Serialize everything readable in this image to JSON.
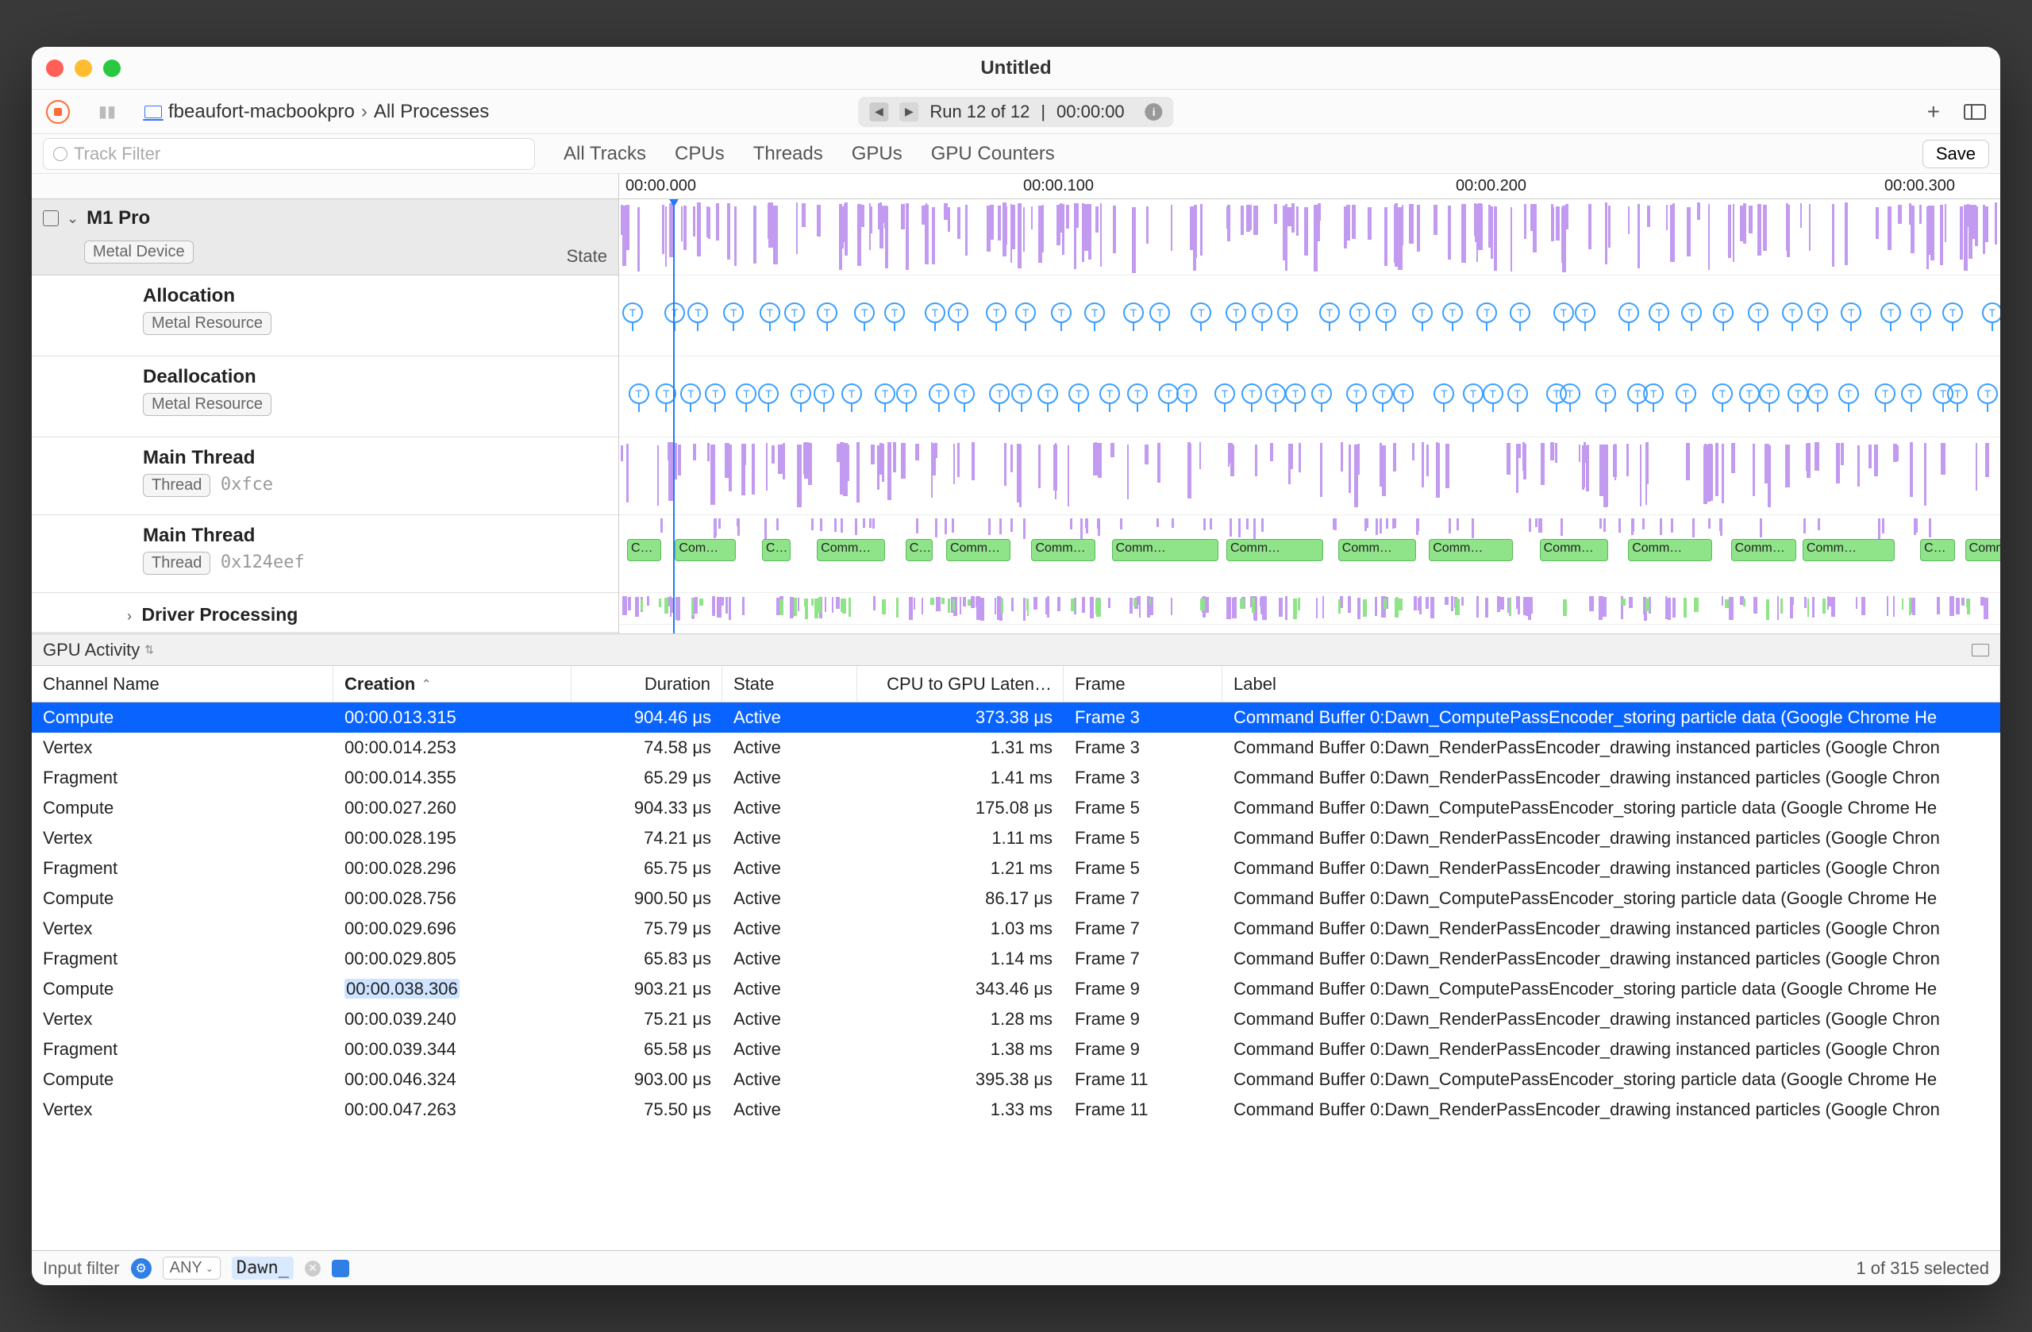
{
  "window": {
    "title": "Untitled"
  },
  "breadcrumb": {
    "host": "fbeaufort-macbookpro",
    "process": "All Processes"
  },
  "run_info": {
    "label": "Run 12 of 12",
    "time": "00:00:00"
  },
  "tabs": [
    "All Tracks",
    "CPUs",
    "Threads",
    "GPUs",
    "GPU Counters"
  ],
  "track_filter_placeholder": "Track Filter",
  "save_label": "Save",
  "ruler": [
    "00:00.000",
    "00:00.100",
    "00:00.200",
    "00:00.300"
  ],
  "device": {
    "name": "M1 Pro",
    "badge": "Metal Device",
    "state_label": "State"
  },
  "tracks": [
    {
      "name": "Allocation",
      "badge": "Metal Resource"
    },
    {
      "name": "Deallocation",
      "badge": "Metal Resource"
    },
    {
      "name": "Main Thread",
      "badge": "Thread",
      "addr": "0xfce"
    },
    {
      "name": "Main Thread",
      "badge": "Thread",
      "addr": "0x124eef"
    },
    {
      "name": "Driver Processing",
      "badge": null
    }
  ],
  "section": "GPU Activity",
  "columns": {
    "channel": "Channel Name",
    "creation": "Creation",
    "duration": "Duration",
    "state": "State",
    "latency": "CPU to GPU Laten…",
    "frame": "Frame",
    "label": "Label"
  },
  "rows": [
    {
      "channel": "Compute",
      "creation": "00:00.013.315",
      "duration": "904.46 μs",
      "state": "Active",
      "latency": "373.38 μs",
      "frame": "Frame 3",
      "label": "Command Buffer 0:Dawn_ComputePassEncoder_storing particle data   (Google Chrome He",
      "selected": true
    },
    {
      "channel": "Vertex",
      "creation": "00:00.014.253",
      "duration": "74.58 μs",
      "state": "Active",
      "latency": "1.31 ms",
      "frame": "Frame 3",
      "label": "Command Buffer 0:Dawn_RenderPassEncoder_drawing instanced particles   (Google Chron"
    },
    {
      "channel": "Fragment",
      "creation": "00:00.014.355",
      "duration": "65.29 μs",
      "state": "Active",
      "latency": "1.41 ms",
      "frame": "Frame 3",
      "label": "Command Buffer 0:Dawn_RenderPassEncoder_drawing instanced particles   (Google Chron"
    },
    {
      "channel": "Compute",
      "creation": "00:00.027.260",
      "duration": "904.33 μs",
      "state": "Active",
      "latency": "175.08 μs",
      "frame": "Frame 5",
      "label": "Command Buffer 0:Dawn_ComputePassEncoder_storing particle data   (Google Chrome He"
    },
    {
      "channel": "Vertex",
      "creation": "00:00.028.195",
      "duration": "74.21 μs",
      "state": "Active",
      "latency": "1.11 ms",
      "frame": "Frame 5",
      "label": "Command Buffer 0:Dawn_RenderPassEncoder_drawing instanced particles   (Google Chron"
    },
    {
      "channel": "Fragment",
      "creation": "00:00.028.296",
      "duration": "65.75 μs",
      "state": "Active",
      "latency": "1.21 ms",
      "frame": "Frame 5",
      "label": "Command Buffer 0:Dawn_RenderPassEncoder_drawing instanced particles   (Google Chron"
    },
    {
      "channel": "Compute",
      "creation": "00:00.028.756",
      "duration": "900.50 μs",
      "state": "Active",
      "latency": "86.17 μs",
      "frame": "Frame 7",
      "label": "Command Buffer 0:Dawn_ComputePassEncoder_storing particle data   (Google Chrome He"
    },
    {
      "channel": "Vertex",
      "creation": "00:00.029.696",
      "duration": "75.79 μs",
      "state": "Active",
      "latency": "1.03 ms",
      "frame": "Frame 7",
      "label": "Command Buffer 0:Dawn_RenderPassEncoder_drawing instanced particles   (Google Chron"
    },
    {
      "channel": "Fragment",
      "creation": "00:00.029.805",
      "duration": "65.83 μs",
      "state": "Active",
      "latency": "1.14 ms",
      "frame": "Frame 7",
      "label": "Command Buffer 0:Dawn_RenderPassEncoder_drawing instanced particles   (Google Chron"
    },
    {
      "channel": "Compute",
      "creation": "00:00.038.306",
      "duration": "903.21 μs",
      "state": "Active",
      "latency": "343.46 μs",
      "frame": "Frame 9",
      "label": "Command Buffer 0:Dawn_ComputePassEncoder_storing particle data   (Google Chrome He",
      "highlight_creation": true
    },
    {
      "channel": "Vertex",
      "creation": "00:00.039.240",
      "duration": "75.21 μs",
      "state": "Active",
      "latency": "1.28 ms",
      "frame": "Frame 9",
      "label": "Command Buffer 0:Dawn_RenderPassEncoder_drawing instanced particles   (Google Chron"
    },
    {
      "channel": "Fragment",
      "creation": "00:00.039.344",
      "duration": "65.58 μs",
      "state": "Active",
      "latency": "1.38 ms",
      "frame": "Frame 9",
      "label": "Command Buffer 0:Dawn_RenderPassEncoder_drawing instanced particles   (Google Chron"
    },
    {
      "channel": "Compute",
      "creation": "00:00.046.324",
      "duration": "903.00 μs",
      "state": "Active",
      "latency": "395.38 μs",
      "frame": "Frame 11",
      "label": "Command Buffer 0:Dawn_ComputePassEncoder_storing particle data   (Google Chrome He"
    },
    {
      "channel": "Vertex",
      "creation": "00:00.047.263",
      "duration": "75.50 μs",
      "state": "Active",
      "latency": "1.33 ms",
      "frame": "Frame 11",
      "label": "Command Buffer 0:Dawn_RenderPassEncoder_drawing instanced particles   (Google Chron"
    }
  ],
  "filter": {
    "placeholder": "Input filter",
    "scope": "ANY",
    "text": "Dawn_",
    "status": "1 of 315 selected"
  }
}
